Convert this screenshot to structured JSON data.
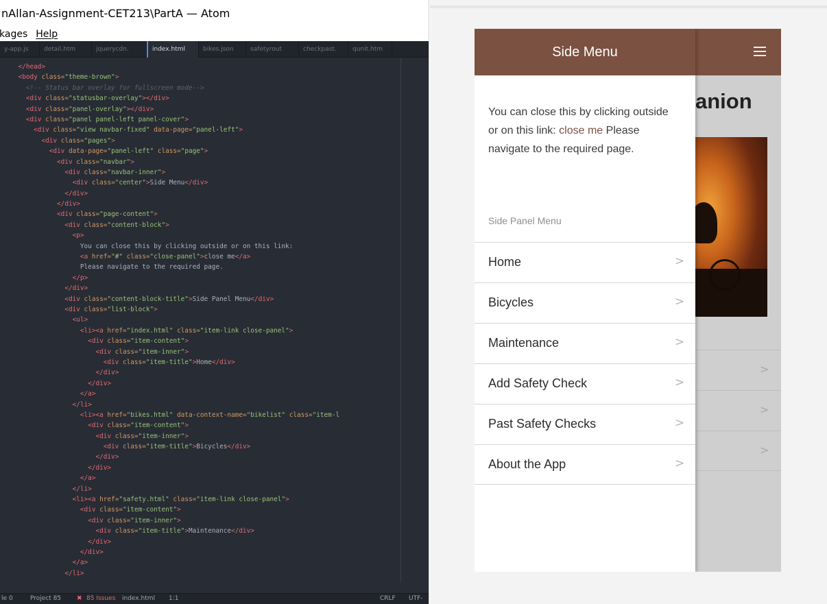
{
  "editor": {
    "title": "nAllan-Assignment-CET213\\PartA — Atom",
    "menu": [
      "kages",
      "Help"
    ],
    "tabs": [
      {
        "label": "y-app.js"
      },
      {
        "label": "detail.htm"
      },
      {
        "label": "jquerycdn."
      },
      {
        "label": "index.html"
      },
      {
        "label": "bikes.json"
      },
      {
        "label": "safetyrout"
      },
      {
        "label": "checkpast."
      },
      {
        "label": "qunit.htm"
      }
    ],
    "code": [
      [
        [
          "    ",
          ""
        ],
        [
          "</head>",
          "tg"
        ]
      ],
      [
        [
          "    ",
          ""
        ],
        [
          "<body ",
          "tg"
        ],
        [
          "class=",
          "at"
        ],
        [
          "\"theme-brown\"",
          "st"
        ],
        [
          ">",
          "tg"
        ]
      ],
      [
        [
          "      ",
          ""
        ],
        [
          "<!-- Status bar overlay for fullscreen mode-->",
          "cm"
        ]
      ],
      [
        [
          "      ",
          ""
        ],
        [
          "<div ",
          "tg"
        ],
        [
          "class=",
          "at"
        ],
        [
          "\"statusbar-overlay\"",
          "st"
        ],
        [
          "></div>",
          "tg"
        ]
      ],
      [
        [
          "      ",
          ""
        ],
        [
          "<div ",
          "tg"
        ],
        [
          "class=",
          "at"
        ],
        [
          "\"panel-overlay\"",
          "st"
        ],
        [
          "></div>",
          "tg"
        ]
      ],
      [
        [
          "      ",
          ""
        ],
        [
          "<div ",
          "tg"
        ],
        [
          "class=",
          "at"
        ],
        [
          "\"panel panel-left panel-cover\"",
          "st"
        ],
        [
          ">",
          "tg"
        ]
      ],
      [
        [
          "        ",
          ""
        ],
        [
          "<div ",
          "tg"
        ],
        [
          "class=",
          "at"
        ],
        [
          "\"view navbar-fixed\" ",
          "st"
        ],
        [
          "data-page=",
          "at"
        ],
        [
          "\"panel-left\"",
          "st"
        ],
        [
          ">",
          "tg"
        ]
      ],
      [
        [
          "          ",
          ""
        ],
        [
          "<div ",
          "tg"
        ],
        [
          "class=",
          "at"
        ],
        [
          "\"pages\"",
          "st"
        ],
        [
          ">",
          "tg"
        ]
      ],
      [
        [
          "            ",
          ""
        ],
        [
          "<div ",
          "tg"
        ],
        [
          "data-page=",
          "at"
        ],
        [
          "\"panel-left\" ",
          "st"
        ],
        [
          "class=",
          "at"
        ],
        [
          "\"page\"",
          "st"
        ],
        [
          ">",
          "tg"
        ]
      ],
      [
        [
          "              ",
          ""
        ],
        [
          "<div ",
          "tg"
        ],
        [
          "class=",
          "at"
        ],
        [
          "\"navbar\"",
          "st"
        ],
        [
          ">",
          "tg"
        ]
      ],
      [
        [
          "                ",
          ""
        ],
        [
          "<div ",
          "tg"
        ],
        [
          "class=",
          "at"
        ],
        [
          "\"navbar-inner\"",
          "st"
        ],
        [
          ">",
          "tg"
        ]
      ],
      [
        [
          "                  ",
          ""
        ],
        [
          "<div ",
          "tg"
        ],
        [
          "class=",
          "at"
        ],
        [
          "\"center\"",
          "st"
        ],
        [
          ">",
          "tg"
        ],
        [
          "Side Menu",
          ""
        ],
        [
          "</div>",
          "tg"
        ]
      ],
      [
        [
          "                ",
          ""
        ],
        [
          "</div>",
          "tg"
        ]
      ],
      [
        [
          "              ",
          ""
        ],
        [
          "</div>",
          "tg"
        ]
      ],
      [
        [
          "              ",
          ""
        ],
        [
          "<div ",
          "tg"
        ],
        [
          "class=",
          "at"
        ],
        [
          "\"page-content\"",
          "st"
        ],
        [
          ">",
          "tg"
        ]
      ],
      [
        [
          "                ",
          ""
        ],
        [
          "<div ",
          "tg"
        ],
        [
          "class=",
          "at"
        ],
        [
          "\"content-block\"",
          "st"
        ],
        [
          ">",
          "tg"
        ]
      ],
      [
        [
          "                  ",
          ""
        ],
        [
          "<p>",
          "tg"
        ]
      ],
      [
        [
          "                    ",
          ""
        ],
        [
          "You can close this by clicking outside or on this link:",
          ""
        ]
      ],
      [
        [
          "                    ",
          ""
        ],
        [
          "<a ",
          "tg"
        ],
        [
          "href=",
          "at"
        ],
        [
          "\"#\" ",
          "st"
        ],
        [
          "class=",
          "at"
        ],
        [
          "\"close-panel\"",
          "st"
        ],
        [
          ">",
          "tg"
        ],
        [
          "close me",
          ""
        ],
        [
          "</a>",
          "tg"
        ]
      ],
      [
        [
          "                    ",
          ""
        ],
        [
          "Please navigate to the required page.",
          ""
        ]
      ],
      [
        [
          "                  ",
          ""
        ],
        [
          "</p>",
          "tg"
        ]
      ],
      [
        [
          "                ",
          ""
        ],
        [
          "</div>",
          "tg"
        ]
      ],
      [
        [
          "                ",
          ""
        ],
        [
          "<div ",
          "tg"
        ],
        [
          "class=",
          "at"
        ],
        [
          "\"content-block-title\"",
          "st"
        ],
        [
          ">",
          "tg"
        ],
        [
          "Side Panel Menu",
          ""
        ],
        [
          "</div>",
          "tg"
        ]
      ],
      [
        [
          "                ",
          ""
        ],
        [
          "<div ",
          "tg"
        ],
        [
          "class=",
          "at"
        ],
        [
          "\"list-block\"",
          "st"
        ],
        [
          ">",
          "tg"
        ]
      ],
      [
        [
          "                  ",
          ""
        ],
        [
          "<ul>",
          "tg"
        ]
      ],
      [
        [
          "                    ",
          ""
        ],
        [
          "<li><a ",
          "tg"
        ],
        [
          "href=",
          "at"
        ],
        [
          "\"index.html\" ",
          "st"
        ],
        [
          "class=",
          "at"
        ],
        [
          "\"item-link close-panel\"",
          "st"
        ],
        [
          ">",
          "tg"
        ]
      ],
      [
        [
          "                      ",
          ""
        ],
        [
          "<div ",
          "tg"
        ],
        [
          "class=",
          "at"
        ],
        [
          "\"item-content\"",
          "st"
        ],
        [
          ">",
          "tg"
        ]
      ],
      [
        [
          "                        ",
          ""
        ],
        [
          "<div ",
          "tg"
        ],
        [
          "class=",
          "at"
        ],
        [
          "\"item-inner\"",
          "st"
        ],
        [
          ">",
          "tg"
        ]
      ],
      [
        [
          "                          ",
          ""
        ],
        [
          "<div ",
          "tg"
        ],
        [
          "class=",
          "at"
        ],
        [
          "\"item-title\"",
          "st"
        ],
        [
          ">",
          "tg"
        ],
        [
          "Home",
          ""
        ],
        [
          "</div>",
          "tg"
        ]
      ],
      [
        [
          "                        ",
          ""
        ],
        [
          "</div>",
          "tg"
        ]
      ],
      [
        [
          "                      ",
          ""
        ],
        [
          "</div>",
          "tg"
        ]
      ],
      [
        [
          "                    ",
          ""
        ],
        [
          "</a>",
          "tg"
        ]
      ],
      [
        [
          "                  ",
          ""
        ],
        [
          "</li>",
          "tg"
        ]
      ],
      [
        [
          "                    ",
          ""
        ],
        [
          "<li><a ",
          "tg"
        ],
        [
          "href=",
          "at"
        ],
        [
          "\"bikes.html\" ",
          "st"
        ],
        [
          "data-context-name=",
          "at"
        ],
        [
          "\"bikelist\" ",
          "st"
        ],
        [
          "class=",
          "at"
        ],
        [
          "\"item-l",
          "st"
        ]
      ],
      [
        [
          "                      ",
          ""
        ],
        [
          "<div ",
          "tg"
        ],
        [
          "class=",
          "at"
        ],
        [
          "\"item-content\"",
          "st"
        ],
        [
          ">",
          "tg"
        ]
      ],
      [
        [
          "                        ",
          ""
        ],
        [
          "<div ",
          "tg"
        ],
        [
          "class=",
          "at"
        ],
        [
          "\"item-inner\"",
          "st"
        ],
        [
          ">",
          "tg"
        ]
      ],
      [
        [
          "                          ",
          ""
        ],
        [
          "<div ",
          "tg"
        ],
        [
          "class=",
          "at"
        ],
        [
          "\"item-title\"",
          "st"
        ],
        [
          ">",
          "tg"
        ],
        [
          "Bicycles",
          ""
        ],
        [
          "</div>",
          "tg"
        ]
      ],
      [
        [
          "                        ",
          ""
        ],
        [
          "</div>",
          "tg"
        ]
      ],
      [
        [
          "                      ",
          ""
        ],
        [
          "</div>",
          "tg"
        ]
      ],
      [
        [
          "                    ",
          ""
        ],
        [
          "</a>",
          "tg"
        ]
      ],
      [
        [
          "                  ",
          ""
        ],
        [
          "</li>",
          "tg"
        ]
      ],
      [
        [
          "                  ",
          ""
        ],
        [
          "<li><a ",
          "tg"
        ],
        [
          "href=",
          "at"
        ],
        [
          "\"safety.html\" ",
          "st"
        ],
        [
          "class=",
          "at"
        ],
        [
          "\"item-link close-panel\"",
          "st"
        ],
        [
          ">",
          "tg"
        ]
      ],
      [
        [
          "                    ",
          ""
        ],
        [
          "<div ",
          "tg"
        ],
        [
          "class=",
          "at"
        ],
        [
          "\"item-content\"",
          "st"
        ],
        [
          ">",
          "tg"
        ]
      ],
      [
        [
          "                      ",
          ""
        ],
        [
          "<div ",
          "tg"
        ],
        [
          "class=",
          "at"
        ],
        [
          "\"item-inner\"",
          "st"
        ],
        [
          ">",
          "tg"
        ]
      ],
      [
        [
          "                        ",
          ""
        ],
        [
          "<div ",
          "tg"
        ],
        [
          "class=",
          "at"
        ],
        [
          "\"item-title\"",
          "st"
        ],
        [
          ">",
          "tg"
        ],
        [
          "Maintenance",
          ""
        ],
        [
          "</div>",
          "tg"
        ]
      ],
      [
        [
          "                      ",
          ""
        ],
        [
          "</div>",
          "tg"
        ]
      ],
      [
        [
          "                    ",
          ""
        ],
        [
          "</div>",
          "tg"
        ]
      ],
      [
        [
          "                  ",
          ""
        ],
        [
          "</a>",
          "tg"
        ]
      ],
      [
        [
          "                ",
          ""
        ],
        [
          "</li>",
          "tg"
        ]
      ]
    ],
    "status": {
      "file_count": "le 0",
      "project": "Project 85",
      "issues": "85 Issues",
      "file": "index.html",
      "cursor": "1:1",
      "line_ending": "CRLF",
      "encoding": "UTF-"
    }
  },
  "app": {
    "panel_title": "Side Menu",
    "intro": "You can close this by clicking outside or on this link:",
    "close_link": "close me",
    "navigate_text": "Please navigate to the required page.",
    "block_title": "Side Panel Menu",
    "menu_items": [
      {
        "label": "Home"
      },
      {
        "label": "Bicycles"
      },
      {
        "label": "Maintenance"
      },
      {
        "label": "Add Safety Check"
      },
      {
        "label": "Past Safety Checks"
      },
      {
        "label": "About the App"
      }
    ],
    "chevron": ">",
    "background_title": "anion"
  },
  "colors": {
    "navbar": "#7b5142",
    "link": "#7b5142",
    "editor_bg": "#282c34"
  },
  "icons": {
    "menu": "hamburger-icon",
    "item_arrow": "chevron-right-icon",
    "issues": "error-x-icon"
  }
}
